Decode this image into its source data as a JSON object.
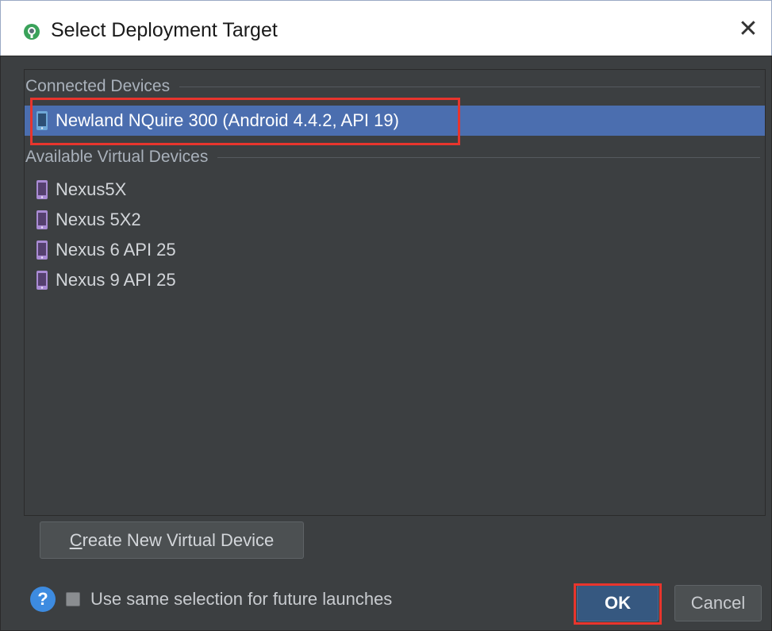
{
  "window": {
    "title": "Select Deployment Target",
    "close_glyph": "✕",
    "app_icon": "android-studio-icon"
  },
  "groups": {
    "connected": {
      "label": "Connected Devices",
      "devices": [
        {
          "label": "Newland NQuire 300 (Android 4.4.2, API 19)",
          "icon": "phone-icon",
          "selected": true
        }
      ]
    },
    "virtual": {
      "label": "Available Virtual Devices",
      "devices": [
        {
          "label": "Nexus5X",
          "icon": "phone-icon"
        },
        {
          "label": "Nexus 5X2",
          "icon": "phone-icon"
        },
        {
          "label": "Nexus 6 API 25",
          "icon": "phone-icon"
        },
        {
          "label": "Nexus 9 API 25",
          "icon": "phone-icon"
        }
      ]
    }
  },
  "actions": {
    "create_mnemonic": "C",
    "create_rest": "reate New Virtual Device",
    "help_glyph": "?",
    "same_selection_label": "Use same selection for future launches",
    "same_selection_checked": false,
    "ok_label": "OK",
    "cancel_label": "Cancel"
  },
  "colors": {
    "selection": "#4b6eaf",
    "panel_bg": "#3c3f41",
    "highlight_red": "#e8352d",
    "device_icon": "#a98bd4",
    "connected_icon": "#6fa8d8"
  }
}
